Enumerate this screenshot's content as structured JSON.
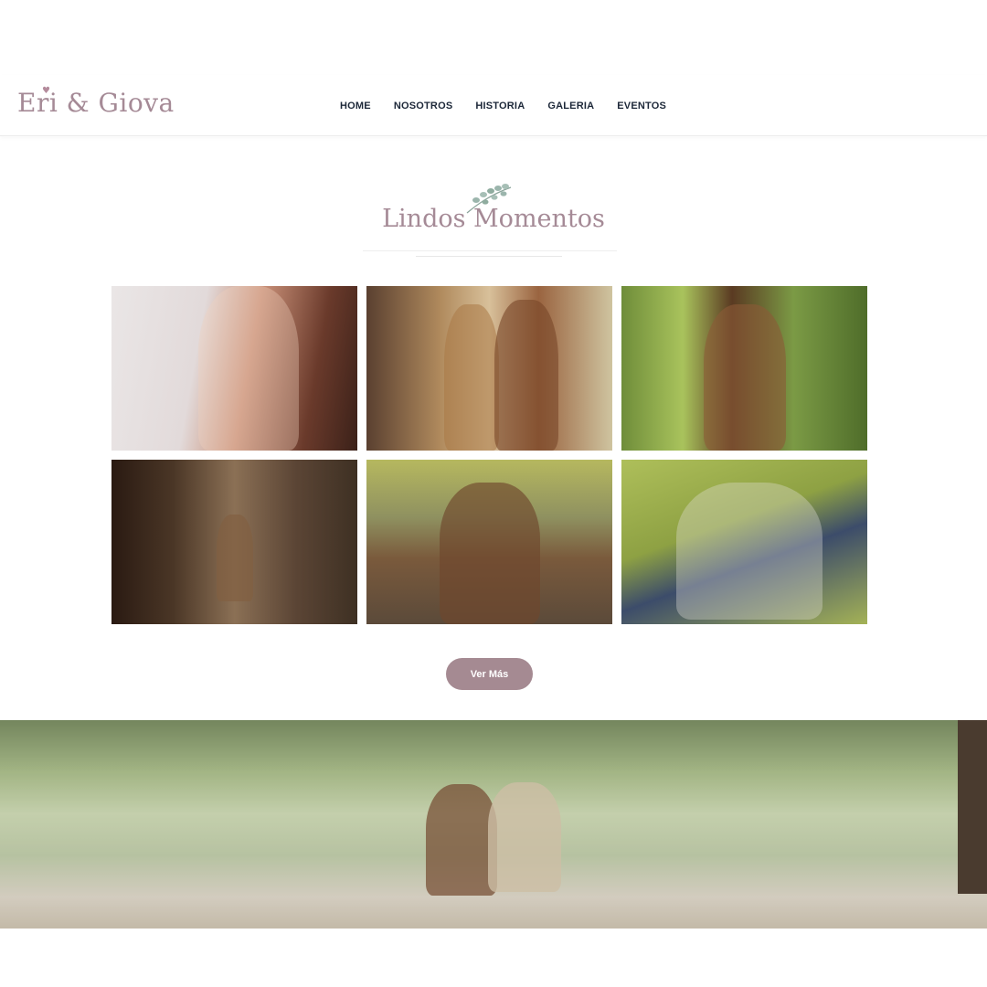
{
  "brand": {
    "logo_text": "Eri & Giova"
  },
  "nav": {
    "items": [
      "HOME",
      "NOSOTROS",
      "HISTORIA",
      "GALERIA",
      "EVENTOS"
    ]
  },
  "gallery": {
    "title": "Lindos Momentos",
    "photos": [
      {
        "icon": "couple-photo-1"
      },
      {
        "icon": "couple-photo-2"
      },
      {
        "icon": "couple-photo-3"
      },
      {
        "icon": "couple-photo-4"
      },
      {
        "icon": "couple-photo-5"
      },
      {
        "icon": "couple-photo-6"
      }
    ],
    "more_label": "Ver Más"
  },
  "colors": {
    "accent": "#a58a92",
    "logo": "#a58a96",
    "nav_text": "#1c2738"
  }
}
